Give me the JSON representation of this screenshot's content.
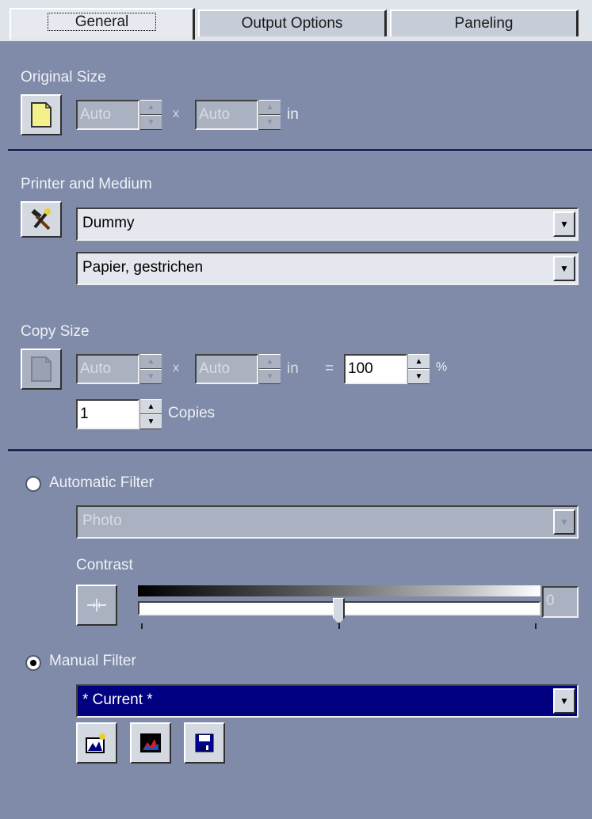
{
  "tabs": [
    {
      "label": "General",
      "active": true
    },
    {
      "label": "Output Options",
      "active": false
    },
    {
      "label": "Paneling",
      "active": false
    }
  ],
  "original_size": {
    "title": "Original Size",
    "width": "Auto",
    "times": "x",
    "height": "Auto",
    "unit": "in"
  },
  "printer": {
    "title": "Printer and Medium",
    "printer_value": "Dummy",
    "medium_value": "Papier, gestrichen"
  },
  "copy_size": {
    "title": "Copy Size",
    "width": "Auto",
    "times": "x",
    "height": "Auto",
    "unit": "in",
    "equals": "=",
    "percent_value": "100",
    "percent_unit": "%",
    "copies_value": "1",
    "copies_label": "Copies"
  },
  "filters": {
    "auto_label": "Automatic Filter",
    "auto_selected": false,
    "auto_value": "Photo",
    "contrast_label": "Contrast",
    "contrast_value": "0",
    "contrast_level": 0.5,
    "manual_label": "Manual Filter",
    "manual_selected": true,
    "manual_value": "* Current *"
  },
  "icons": {
    "original_size_button": "page-icon",
    "printer_button": "tools-icon",
    "copy_size_button": "page-icon",
    "contrast_reset": "center-arrows-icon",
    "filter_new": "new-filter-icon",
    "filter_edit": "histogram-icon",
    "filter_save": "floppy-disk-icon"
  }
}
